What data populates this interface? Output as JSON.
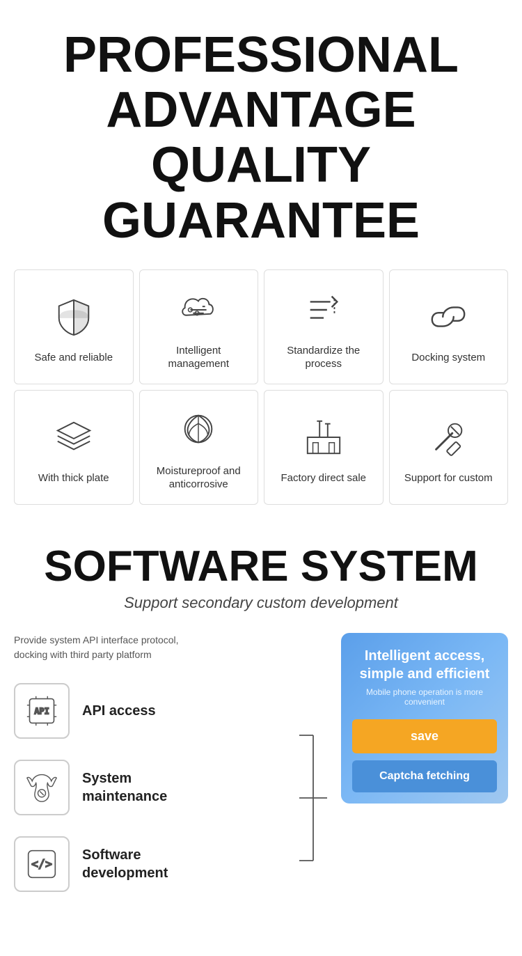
{
  "header": {
    "line1": "PROFESSIONAL",
    "line2": "ADVANTAGE",
    "line3": "QUALITY GUARANTEE"
  },
  "grid": {
    "row1": [
      {
        "label": "Safe and reliable",
        "icon": "shield"
      },
      {
        "label": "Intelligent management",
        "icon": "cloud-settings"
      },
      {
        "label": "Standardize the process",
        "icon": "process"
      },
      {
        "label": "Docking system",
        "icon": "link"
      }
    ],
    "row2": [
      {
        "label": "With thick plate",
        "icon": "layers"
      },
      {
        "label": "Moistureproof and anticorrosive",
        "icon": "leaf"
      },
      {
        "label": "Factory direct sale",
        "icon": "factory"
      },
      {
        "label": "Support for custom",
        "icon": "tools"
      }
    ]
  },
  "software": {
    "title": "SOFTWARE SYSTEM",
    "subtitle": "Support secondary custom development",
    "description": "Provide system API interface protocol,\ndocking with third party platform",
    "features": [
      {
        "label": "API access",
        "icon": "api"
      },
      {
        "label": "System\nmaintenance",
        "icon": "maintenance"
      },
      {
        "label": "Software\ndevelopment",
        "icon": "code"
      }
    ],
    "panel": {
      "main_title": "Intelligent access,\nsimple and efficient",
      "sub_title": "Mobile phone operation is more convenient",
      "save_label": "save",
      "captcha_label": "Captcha fetching"
    }
  }
}
